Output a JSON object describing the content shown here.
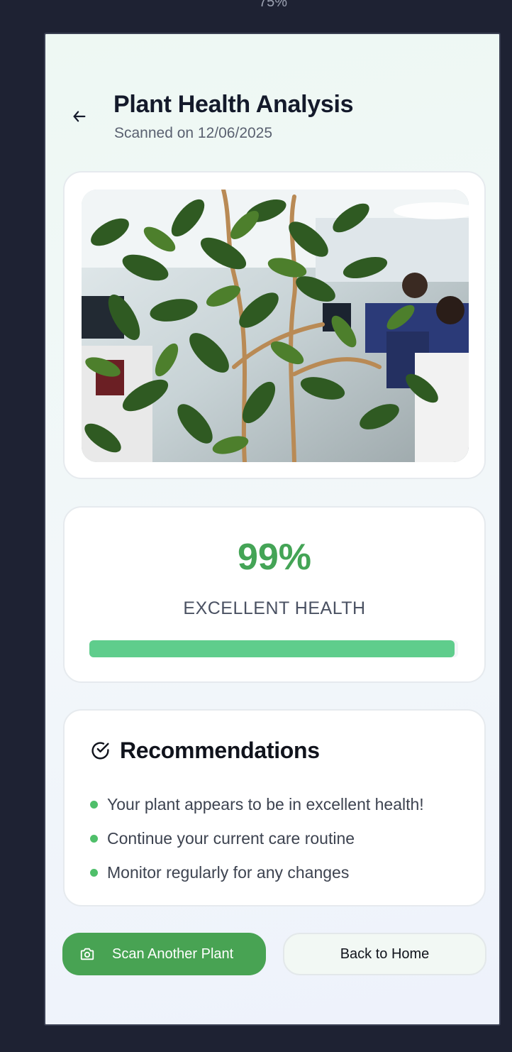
{
  "zoom_level": "75%",
  "header": {
    "title": "Plant Health Analysis",
    "subtitle": "Scanned on 12/06/2025",
    "back_icon": "arrow-left-icon"
  },
  "health": {
    "score": "99%",
    "score_value": 99,
    "status": "EXCELLENT HEALTH",
    "accent_color": "#44a456",
    "bar_color": "#5fcd8c"
  },
  "recommendations": {
    "title": "Recommendations",
    "icon": "check-circle-icon",
    "items": [
      "Your plant appears to be in excellent health!",
      "Continue your current care routine",
      "Monitor regularly for any changes"
    ]
  },
  "actions": {
    "scan_label": "Scan Another Plant",
    "scan_icon": "camera-icon",
    "home_label": "Back to Home"
  }
}
